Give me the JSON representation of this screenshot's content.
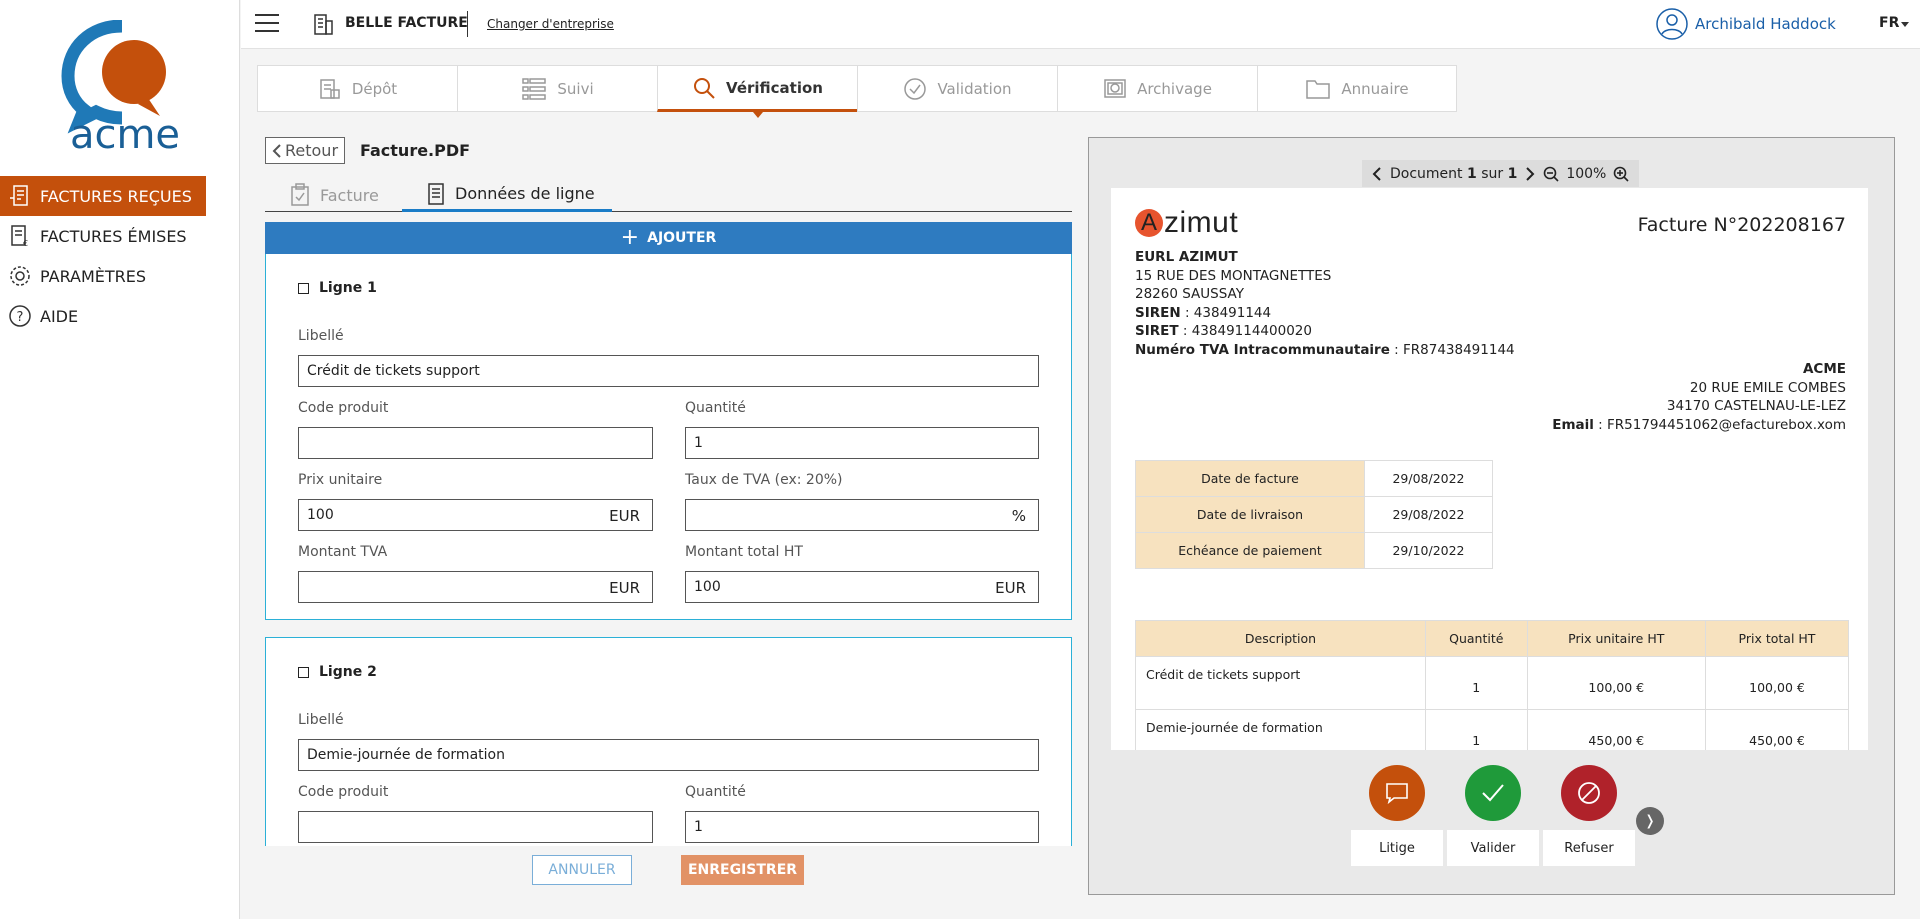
{
  "colors": {
    "accent": "#c4500c",
    "primary": "#2e7bc0",
    "border_blue": "#2bb0d7"
  },
  "sidebar": {
    "logo_text": "acme",
    "items": [
      {
        "label": "FACTURES REÇUES",
        "icon": "invoice-in-icon"
      },
      {
        "label": "FACTURES ÉMISES",
        "icon": "invoice-out-icon"
      },
      {
        "label": "PARAMÈTRES",
        "icon": "gear-icon"
      },
      {
        "label": "AIDE",
        "icon": "help-icon"
      }
    ]
  },
  "header": {
    "company": "BELLE FACTURE",
    "change_company": "Changer d'entreprise",
    "user": "Archibald Haddock",
    "lang": "FR"
  },
  "steps": [
    {
      "label": "Dépôt"
    },
    {
      "label": "Suivi"
    },
    {
      "label": "Vérification"
    },
    {
      "label": "Validation"
    },
    {
      "label": "Archivage"
    },
    {
      "label": "Annuaire"
    }
  ],
  "form": {
    "back_label": "Retour",
    "file_name": "Facture.PDF",
    "tabs": [
      "Facture",
      "Données de ligne"
    ],
    "add_label": "AJOUTER",
    "labels": {
      "libelle": "Libellé",
      "code": "Code produit",
      "quantite": "Quantité",
      "prix": "Prix unitaire",
      "taux": "Taux de TVA (ex: 20%)",
      "montant_tva": "Montant TVA",
      "montant_ht": "Montant total HT",
      "currency": "EUR",
      "percent": "%"
    },
    "lines": [
      {
        "title": "Ligne 1",
        "libelle": "Crédit de tickets support",
        "code": "",
        "quantite": "1",
        "prix": "100",
        "taux": "",
        "montant_tva": "",
        "montant_ht": "100"
      },
      {
        "title": "Ligne 2",
        "libelle": "Demie-journée de formation",
        "code": "",
        "quantite": "1"
      }
    ],
    "cancel_label": "ANNULER",
    "save_label": "ENREGISTRER"
  },
  "viewer": {
    "doc_label": "Document",
    "doc_current": "1",
    "doc_of": "sur",
    "doc_total": "1",
    "zoom": "100%",
    "invoice": {
      "brand_a": "A",
      "brand_rest": "zimut",
      "number": "Facture N°202208167",
      "sender_name": "EURL AZIMUT",
      "sender_street": "15 RUE DES MONTAGNETTES",
      "sender_city": "28260 SAUSSAY",
      "siren_label": "SIREN",
      "siren": " : 438491144",
      "siret_label": "SIRET",
      "siret": " : 43849114400020",
      "tva_label": "Numéro TVA Intracommunautaire",
      "tva": " : FR87438491144",
      "recipient_name": "ACME",
      "recipient_street": "20 RUE EMILE COMBES",
      "recipient_city": "34170 CASTELNAU-LE-LEZ",
      "email_label": "Email",
      "email": " : FR51794451062@efacturebox.xom",
      "dates": [
        {
          "k": "Date de facture",
          "v": "29/08/2022"
        },
        {
          "k": "Date de livraison",
          "v": "29/08/2022"
        },
        {
          "k": "Echéance de paiement",
          "v": "29/10/2022"
        }
      ],
      "items_headers": [
        "Description",
        "Quantité",
        "Prix unitaire HT",
        "Prix total HT"
      ],
      "items": [
        {
          "desc": "Crédit de tickets support",
          "qty": "1",
          "pu": "100,00 €",
          "pt": "100,00 €"
        },
        {
          "desc": "Demie-journée de formation",
          "qty": "1",
          "pu": "450,00 €",
          "pt": "450,00 €"
        }
      ]
    },
    "actions": [
      {
        "label": "Litige",
        "color": "#c4500c"
      },
      {
        "label": "Valider",
        "color": "#1f9a3a"
      },
      {
        "label": "Refuser",
        "color": "#b0222a"
      }
    ]
  }
}
